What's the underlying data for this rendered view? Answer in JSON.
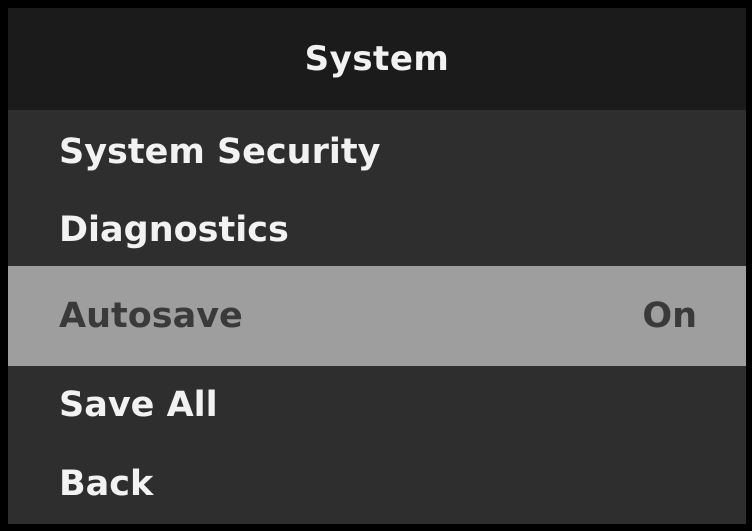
{
  "header": {
    "title": "System"
  },
  "menu": {
    "items": [
      {
        "label": "System Security",
        "value": ""
      },
      {
        "label": "Diagnostics",
        "value": ""
      },
      {
        "label": "Autosave",
        "value": "On",
        "selected": true
      },
      {
        "label": "Save All",
        "value": ""
      },
      {
        "label": "Back",
        "value": ""
      }
    ]
  },
  "colors": {
    "header_bg": "#1b1b1b",
    "menu_bg": "#2e2e2e",
    "selected_bg": "#9e9e9e",
    "text": "#f2f2f2",
    "selected_text": "#3a3a3a"
  }
}
